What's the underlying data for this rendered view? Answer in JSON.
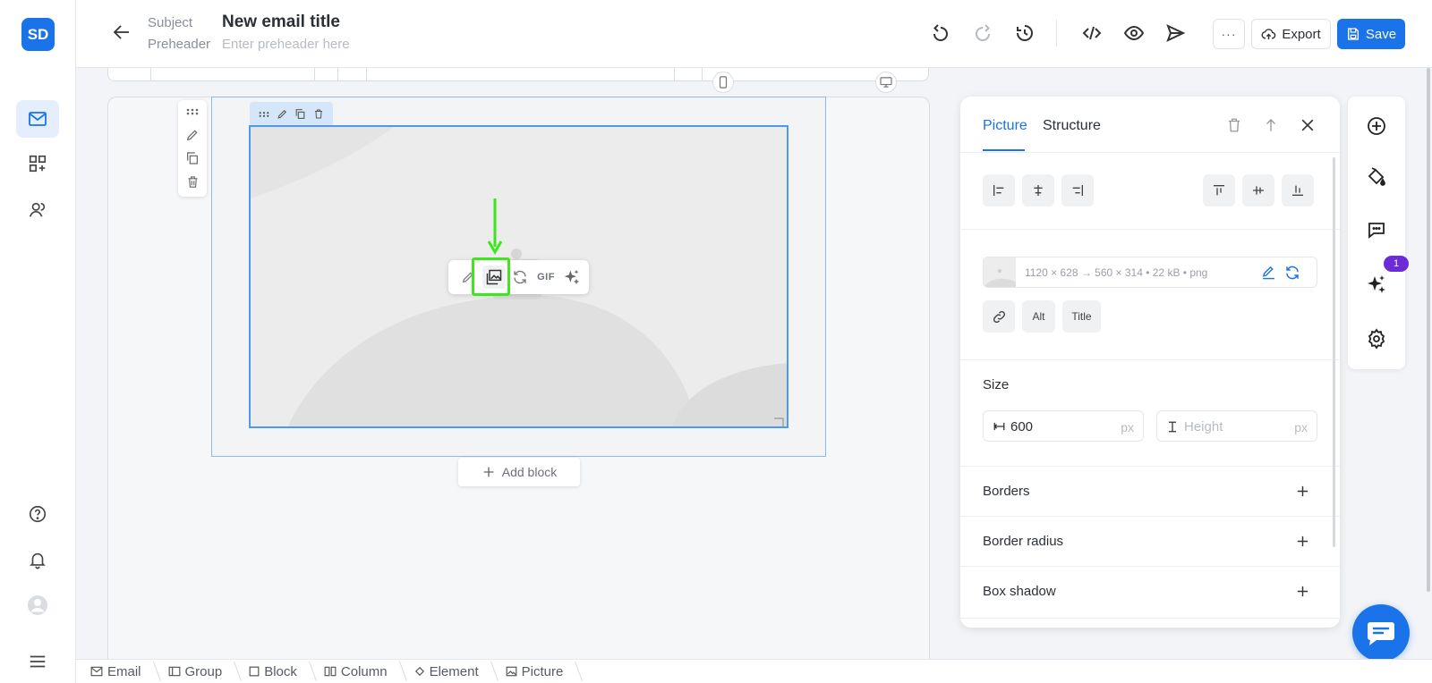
{
  "app": {
    "logo_text": "SD"
  },
  "header": {
    "subject_label": "Subject",
    "preheader_label": "Preheader",
    "title": "New email title",
    "preheader_placeholder": "Enter preheader here",
    "more_label": "···",
    "export_label": "Export",
    "save_label": "Save"
  },
  "canvas": {
    "picture_toolbar": {
      "gif_label": "GIF"
    },
    "add_block_label": "Add block"
  },
  "panel": {
    "tabs": [
      {
        "label": "Picture",
        "active": true
      },
      {
        "label": "Structure",
        "active": false
      }
    ],
    "image_meta": "1120 × 628 → 560 × 314  •  22 kB  •  png",
    "alt_label": "Alt",
    "title_label": "Title",
    "size_label": "Size",
    "width_value": "600",
    "width_unit": "px",
    "height_placeholder": "Height",
    "height_unit": "px",
    "rows": [
      "Borders",
      "Border radius",
      "Box shadow"
    ]
  },
  "right_rail": {
    "badge_count": "1"
  },
  "breadcrumbs": [
    {
      "label": "Email",
      "icon": "mail-icon"
    },
    {
      "label": "Group",
      "icon": "group-icon"
    },
    {
      "label": "Block",
      "icon": "block-icon"
    },
    {
      "label": "Column",
      "icon": "column-icon"
    },
    {
      "label": "Element",
      "icon": "element-icon"
    },
    {
      "label": "Picture",
      "icon": "picture-icon"
    }
  ],
  "colors": {
    "accent": "#1a73e8",
    "highlight": "#3ee61c",
    "badge": "#6b2bd6"
  }
}
